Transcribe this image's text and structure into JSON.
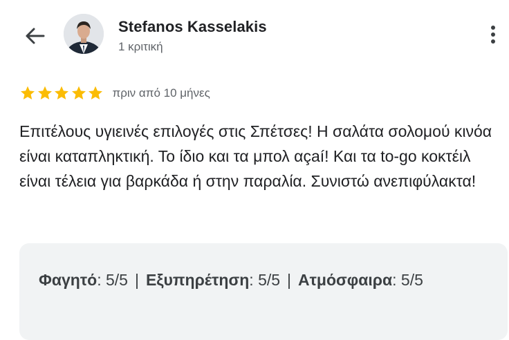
{
  "header": {
    "reviewer_name": "Stefanos Kasselakis",
    "reviewer_meta": "1 κριτική",
    "icons": {
      "back": "arrow-back-icon",
      "more": "more-vert-icon"
    }
  },
  "review": {
    "stars": 5,
    "star_color": "#fbbc04",
    "time": "πριν από 10 μήνες",
    "text": "Επιτέλους υγιεινές επιλογές στις Σπέτσες! Η σαλάτα σολομού κινόα είναι καταπληκτική. Το ίδιο και τα μπολ αçaí! Και τα to-go κοκτέιλ είναι τέλεια για βαρκάδα ή στην παραλία. Συνιστώ ανεπιφύλακτα!"
  },
  "ratings": [
    {
      "label": "Φαγητό",
      "value": "5/5"
    },
    {
      "label": "Εξυπηρέτηση",
      "value": "5/5"
    },
    {
      "label": "Ατμόσφαιρα",
      "value": "5/5"
    }
  ],
  "separator": "|",
  "colon": ":",
  "colors": {
    "text_primary": "#202124",
    "text_secondary": "#5f6368",
    "box_bg": "#f1f3f4"
  }
}
